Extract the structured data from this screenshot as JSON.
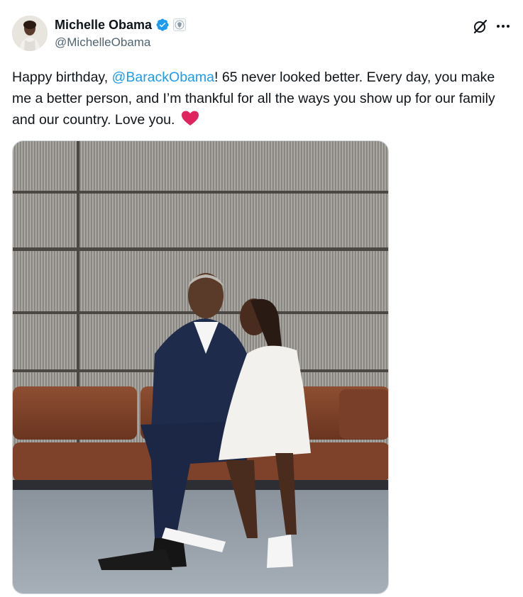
{
  "author": {
    "display_name": "Michelle Obama",
    "handle": "@MichelleObama",
    "verified_badge": "verified-check-icon",
    "affiliate_badge": "government-seal-icon"
  },
  "tweet": {
    "text_before": "Happy birthday, ",
    "mention": "@BarackObama",
    "text_after": "! 65 never looked better. Every day, you make me a better person, and I’m thankful for all the ways you show up for our family and our country. Love you.",
    "emoji": "heart-icon"
  },
  "actions": {
    "grok_icon": "grok-icon",
    "more_icon": "more-icon"
  },
  "colors": {
    "link": "#1d9bf0",
    "verified": "#1d9bf0",
    "heart": "#e0245e",
    "text": "#0f1419",
    "secondary": "#536471"
  }
}
